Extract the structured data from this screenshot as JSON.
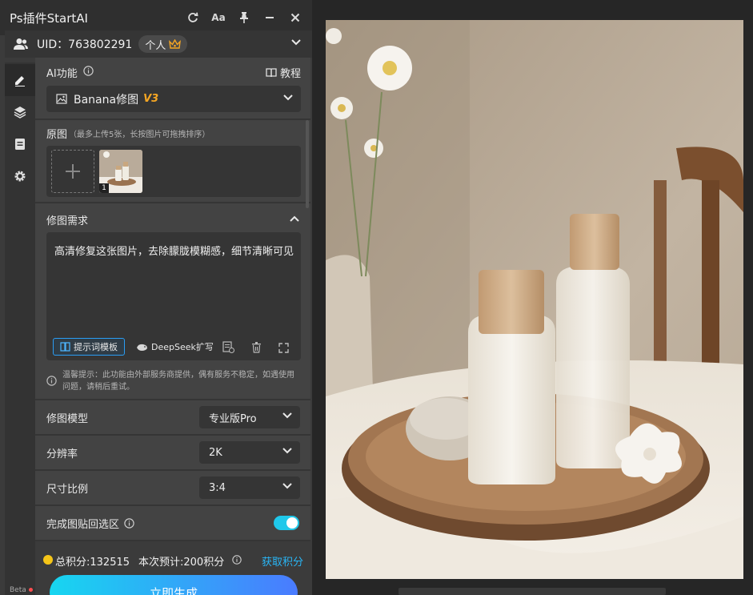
{
  "window": {
    "title": "Ps插件StartAI"
  },
  "user": {
    "uid": "UID：763802291",
    "plan": "个人"
  },
  "ai_function": {
    "label": "AI功能",
    "tutorial": "教程",
    "selected_model": "Banana修图",
    "version": "V3"
  },
  "source_image": {
    "label": "原图",
    "hint": "（最多上传5张，长按图片可拖拽排序）",
    "thumb_index": "1"
  },
  "requirement": {
    "label": "修图需求",
    "text": "高清修复这张图片，去除朦胧模糊感，细节清晰可见",
    "template_btn": "提示词模板",
    "deepseek_btn": "DeepSeek扩写"
  },
  "notice": {
    "text": "温馨提示：此功能由外部服务商提供，偶有服务不稳定，如遇使用问题，请稍后重试。"
  },
  "settings": {
    "model_label": "修图模型",
    "model_value": "专业版Pro",
    "resolution_label": "分辨率",
    "resolution_value": "2K",
    "ratio_label": "尺寸比例",
    "ratio_value": "3:4",
    "paste_label": "完成图贴回选区",
    "paste_enabled": true
  },
  "points": {
    "total": "总积分:132515",
    "estimate": "本次预计:200积分",
    "get_link": "获取积分"
  },
  "generate_btn": "立即生成",
  "beta_label": "Beta",
  "colors": {
    "accent": "#1fc8ea",
    "link": "#29b6f6",
    "version": "#f5a623"
  }
}
